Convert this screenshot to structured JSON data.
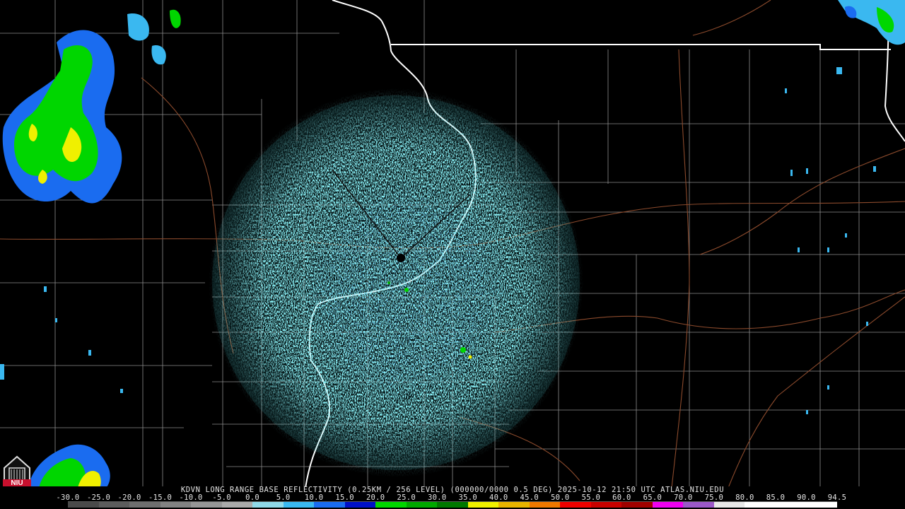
{
  "product": {
    "caption": "KDVN LONG RANGE BASE REFLECTIVITY (0.25KM / 256 LEVEL) (000000/0000 0.5 DEG) 2025-10-12 21:50 UTC  ATLAS.NIU.EDU",
    "logo_text": "NIU"
  },
  "colorscale": {
    "labels": [
      "-30.0",
      "-25.0",
      "-20.0",
      "-15.0",
      "-10.0",
      "-5.0",
      "0.0",
      "5.0",
      "10.0",
      "15.0",
      "20.0",
      "25.0",
      "30.0",
      "35.0",
      "40.0",
      "45.0",
      "50.0",
      "55.0",
      "60.0",
      "65.0",
      "70.0",
      "75.0",
      "80.0",
      "85.0",
      "90.0",
      "94.5"
    ],
    "colors": [
      "#4a4a4a",
      "#5c5c5c",
      "#6e6e6e",
      "#828282",
      "#969696",
      "#aaaaaa",
      "#8fd8e8",
      "#3ab8f0",
      "#1a6cf0",
      "#0010c8",
      "#00d600",
      "#00a800",
      "#007800",
      "#f0f000",
      "#e8b400",
      "#f07800",
      "#f00000",
      "#c80000",
      "#a00000",
      "#f000f0",
      "#9c58c8",
      "#e8e8e8",
      "#ffffff",
      "#ffffff",
      "#ffffff"
    ]
  },
  "map_colors": {
    "state_border": "#ffffff",
    "county_border": "#8c8c8c",
    "highway": "#8b4a2c",
    "reflectivity_primary": "#3fd8e0",
    "reflectivity_secondary": "#1a6cf0"
  },
  "radar_site": "KDVN"
}
